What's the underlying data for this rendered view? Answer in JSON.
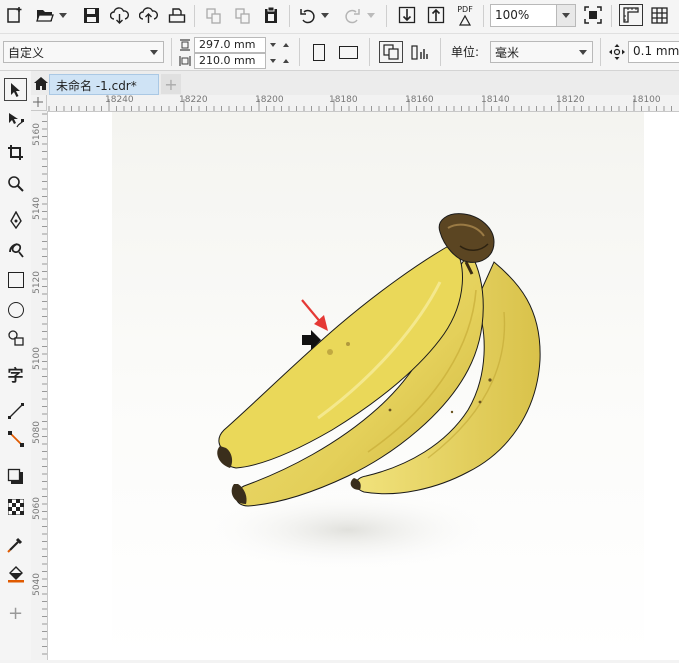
{
  "toolbar": {
    "zoom_value": "100%",
    "pdf_label": "PDF",
    "icons": [
      "new-icon",
      "open-icon",
      "save-icon",
      "cloud-import-icon",
      "cloud-upload-icon",
      "print-icon",
      "copy-icon",
      "paste-icon",
      "clipboard-icon",
      "undo-icon",
      "redo-icon",
      "import-icon",
      "export-icon",
      "publish-pdf-icon",
      "full-screen-icon",
      "rulers-icon",
      "grid-icon"
    ]
  },
  "propbar": {
    "page_preset": "自定义",
    "width_value": "297.0 mm",
    "height_value": "210.0 mm",
    "units_label": "单位:",
    "units_value": "毫米",
    "nudge_value": "0.1 mm"
  },
  "document": {
    "tab_label": "未命名 -1.cdr*",
    "add_tab": "+"
  },
  "ruler": {
    "horizontal": [
      "18240",
      "18220",
      "18200",
      "18180",
      "18160",
      "18140",
      "18120",
      "18100"
    ],
    "vertical": [
      "5160",
      "5140",
      "5120",
      "5100",
      "5080",
      "5060",
      "5040"
    ]
  },
  "toolbox": {
    "text_tool_glyph": "字",
    "add_tool": "+",
    "icons": [
      "pick-tool-icon",
      "shape-tool-icon",
      "crop-tool-icon",
      "zoom-tool-icon",
      "pen-tool-icon",
      "artistic-media-icon",
      "rectangle-tool-icon",
      "ellipse-tool-icon",
      "object-shapes-icon",
      "text-tool-icon",
      "line-tool-icon",
      "connector-tool-icon",
      "drop-shadow-icon",
      "transparency-icon",
      "eyedropper-icon",
      "interactive-fill-icon",
      "add-tool-icon"
    ]
  },
  "colors": {
    "accent": "#cfe3f5",
    "annotation_arrow": "#e53935",
    "banana": "#e9d75a"
  }
}
